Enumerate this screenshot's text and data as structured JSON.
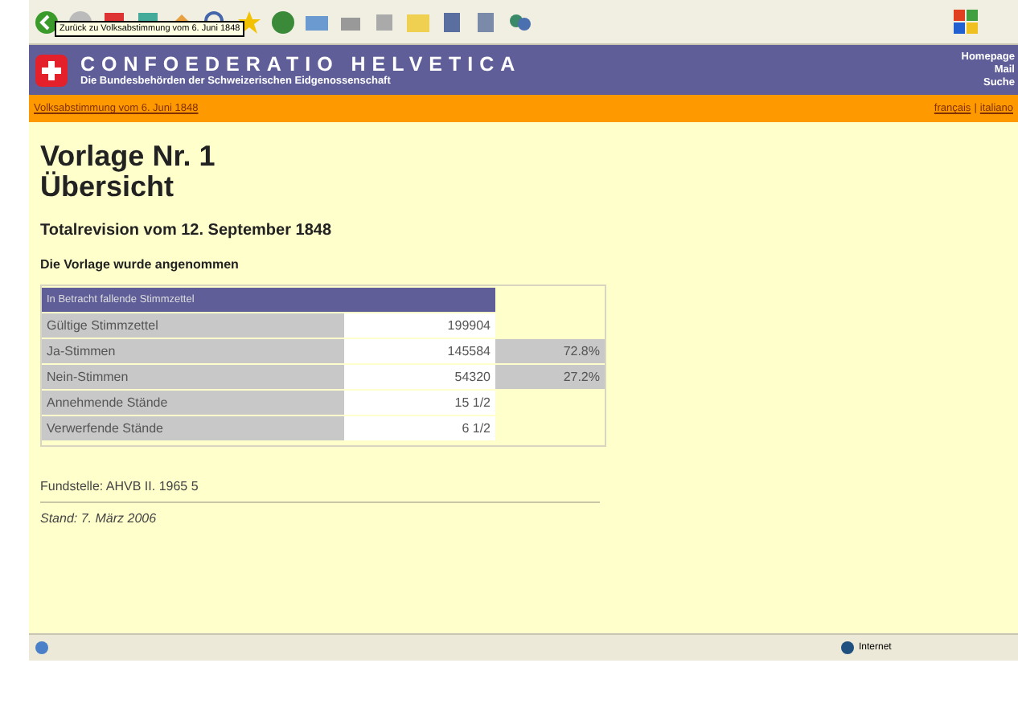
{
  "browser": {
    "tooltip": "Zurück zu Volksabstimmung vom 6. Juni 1848"
  },
  "header": {
    "title": "CONFOEDERATIO HELVETICA",
    "subtitle": "Die Bundesbehörden der Schweizerischen Eidgenossenschaft",
    "links": [
      "Homepage",
      "Mail",
      "Suche"
    ]
  },
  "nav": {
    "breadcrumb": "Volksabstimmung vom 6. Juni 1848",
    "languages": [
      "français",
      "italiano"
    ],
    "separator": "|"
  },
  "heading": [
    "Vorlage Nr. 1",
    "Übersicht"
  ],
  "subtitle": "Totalrevision vom 12. September 1848",
  "result": "Die Vorlage wurde angenommen",
  "table": {
    "caption": "In Betracht fallende Stimmzettel",
    "rows": [
      {
        "label": "Gültige Stimmzettel",
        "value": "199904"
      },
      {
        "label": "Ja-Stimmen",
        "value": "145584",
        "percent": "72.8%"
      },
      {
        "label": "Nein-Stimmen",
        "value": "54320",
        "percent": "27.2%"
      },
      {
        "label": "Annehmende Stände",
        "value": "15 1/2"
      },
      {
        "label": "Verwerfende Stände",
        "value": "6 1/2"
      }
    ]
  },
  "source": "Fundstelle: AHVB II. 1965 5",
  "date": "Stand: 7. März 2006",
  "status_bar": {
    "zone": "Internet"
  }
}
